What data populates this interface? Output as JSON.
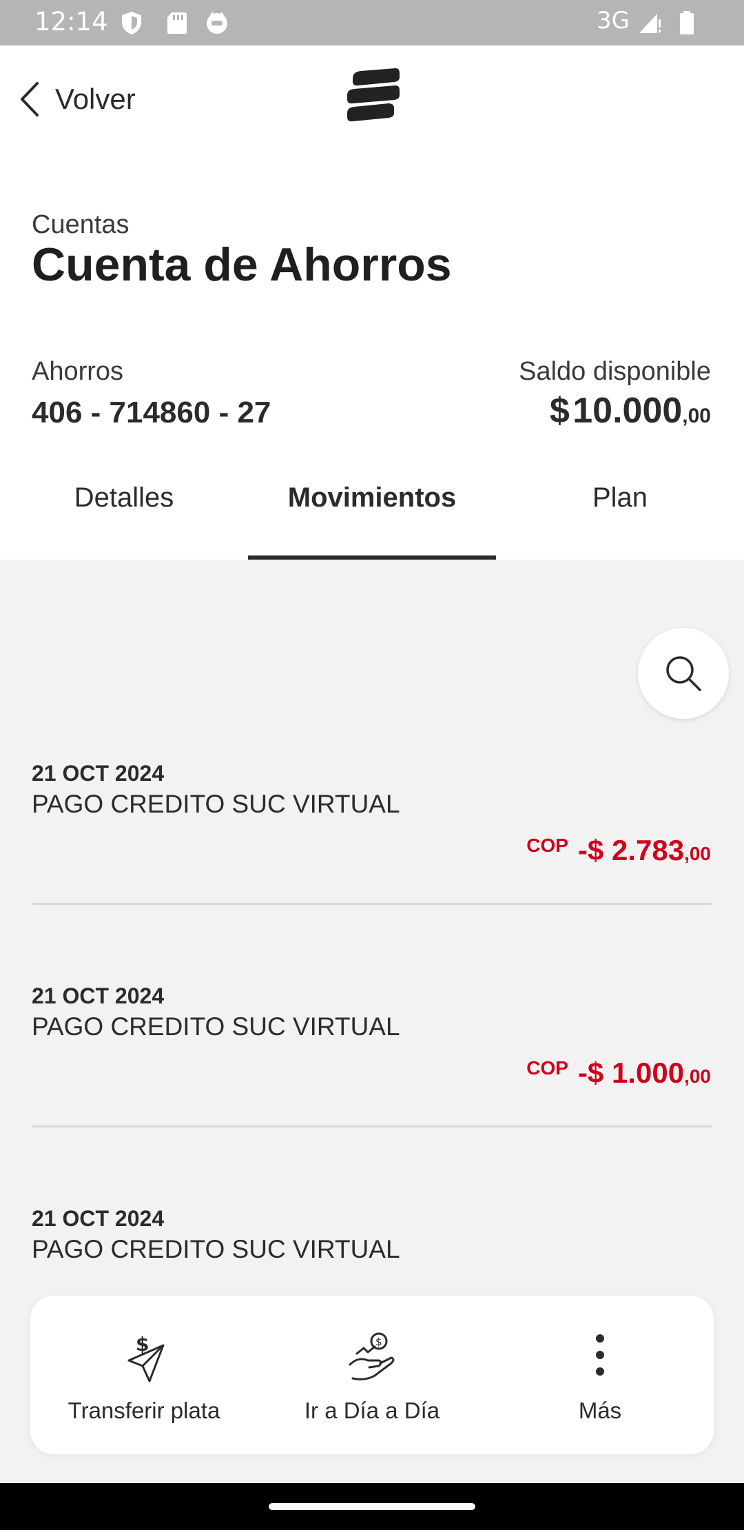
{
  "status_bar": {
    "time": "12:14",
    "network": "3G",
    "icons": [
      "shield-icon",
      "sd-card-icon",
      "cat-face-icon",
      "signal-icon",
      "battery-icon"
    ]
  },
  "header": {
    "back_label": "Volver",
    "logo": "bank-logo-icon"
  },
  "account": {
    "breadcrumb": "Cuentas",
    "title": "Cuenta de Ahorros",
    "type": "Ahorros",
    "number": "406 - 714860 - 27",
    "balance_label": "Saldo disponible",
    "balance_currency": "$",
    "balance_integer": "10.000",
    "balance_decimal": ",00"
  },
  "tabs": [
    {
      "label": "Detalles",
      "active": false
    },
    {
      "label": "Movimientos",
      "active": true
    },
    {
      "label": "Plan",
      "active": false
    }
  ],
  "search": {
    "icon": "search-icon"
  },
  "transactions": [
    {
      "date": "21 OCT 2024",
      "description": "PAGO CREDITO SUC VIRTUAL",
      "currency_code": "COP",
      "amount_integer": "-$ 2.783",
      "amount_decimal": ",00"
    },
    {
      "date": "21 OCT 2024",
      "description": "PAGO CREDITO SUC VIRTUAL",
      "currency_code": "COP",
      "amount_integer": "-$ 1.000",
      "amount_decimal": ",00"
    },
    {
      "date": "21 OCT 2024",
      "description": "PAGO CREDITO SUC VIRTUAL",
      "currency_code": "",
      "amount_integer": "",
      "amount_decimal": ""
    }
  ],
  "actions": [
    {
      "label": "Transferir plata",
      "icon": "send-money-icon"
    },
    {
      "label": "Ir a Día a Día",
      "icon": "hand-money-icon"
    },
    {
      "label": "Más",
      "icon": "more-vertical-icon"
    }
  ],
  "colors": {
    "accent_red": "#d0021b",
    "background_gray": "#f2f2f3",
    "status_bar": "#b5b5b5"
  }
}
